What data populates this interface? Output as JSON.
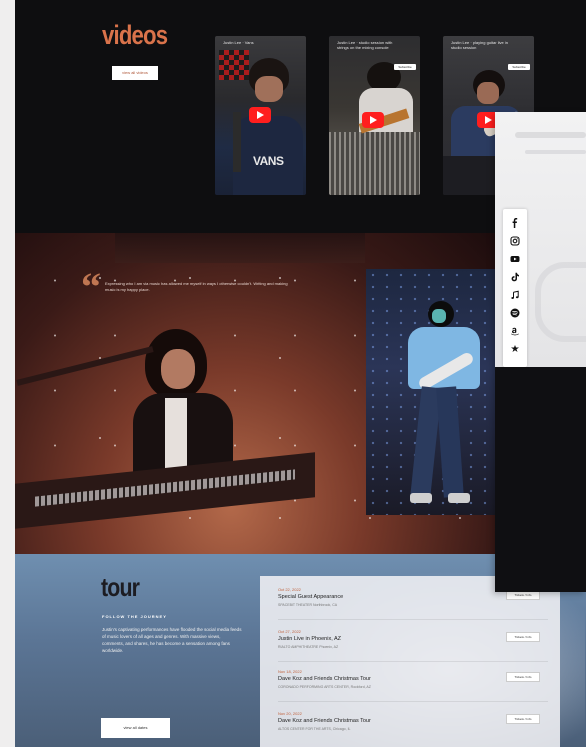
{
  "videos": {
    "title": "videos",
    "button_label": "view all videos",
    "cards": [
      {
        "title": "Justin Lee · Vans",
        "subscribe": ""
      },
      {
        "title": "Justin Lee · studio session with strings on the mixing console",
        "subscribe": "Subscribe"
      },
      {
        "title": "Justin Lee · playing guitar live in studio session",
        "subscribe": "Subscribe"
      }
    ]
  },
  "hero": {
    "quote_mark": "“",
    "quote_text": "Expressing who I am via music has allowed me myself in ways I otherwise couldn't. Writing and making music is my happy place."
  },
  "tour": {
    "title": "tour",
    "subtitle": "FOLLOW THE JOURNEY",
    "description": "Justin's captivating performances have flooded the social media feeds of music lovers of all ages and genres. With massive views, comments, and shares, he has become a sensation among fans worldwide.",
    "button_label": "view all dates",
    "events": [
      {
        "date": "Oct 22, 2022",
        "name": "Special Guest Appearance",
        "venue": "SPACEBIT THEATER Northbrook, CA",
        "ticket": "Tickets / Info"
      },
      {
        "date": "Oct 27, 2022",
        "name": "Justin Live in Phoenix, AZ",
        "venue": "RIALTO AMPHITHEATRE Phoenix, AZ",
        "ticket": "Tickets / Info"
      },
      {
        "date": "Nov 18, 2022",
        "name": "Dave Koz and Friends Christmas Tour",
        "venue": "CORONADO PERFORMING ARTS CENTER, Rockford, AZ",
        "ticket": "Tickets / Info"
      },
      {
        "date": "Nov 20, 2022",
        "name": "Dave Koz and Friends Christmas Tour",
        "venue": "ALTOS CENTER FOR THE ARTS, Chicago, IL",
        "ticket": "Tickets / Info"
      }
    ]
  },
  "social": {
    "icons": [
      "facebook-icon",
      "instagram-icon",
      "youtube-icon",
      "tiktok-icon",
      "apple-music-icon",
      "spotify-icon",
      "amazon-icon",
      "streaming-icon"
    ]
  },
  "colors": {
    "accent": "#d9734b",
    "dark_bg": "#0e0e10",
    "tour_bg": "#5b7595"
  }
}
